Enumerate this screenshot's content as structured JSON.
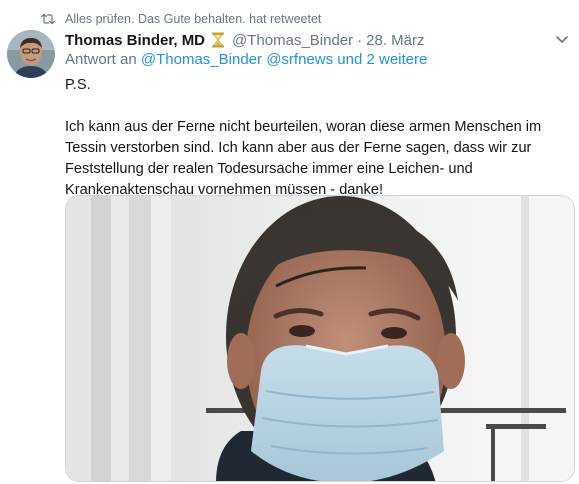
{
  "retweet_context": {
    "text": "Alles prüfen. Das Gute behalten. hat retweetet",
    "icon": "retweet-icon"
  },
  "tweet": {
    "author_name": "Thomas Binder, MD",
    "badge_icon": "hourglass-icon",
    "handle": "@Thomas_Binder",
    "separator": "·",
    "date": "28. März",
    "reply": {
      "prefix": "Antwort an",
      "mentions": [
        "@Thomas_Binder",
        "@srfnews"
      ],
      "suffix": "und 2 weitere"
    },
    "body": {
      "ps": "P.S.",
      "paragraph": "Ich kann aus der Ferne nicht beurteilen, woran diese armen Menschen im Tessin verstorben sind. Ich kann aber aus der Ferne sagen, dass wir zur Feststellung der realen Todesursache immer eine Leichen- und Krankenaktenschau vornehmen müssen - danke!"
    },
    "media": {
      "type": "photo"
    }
  },
  "colors": {
    "link": "#1b95e0",
    "secondary_text": "#657786",
    "primary_text": "#14171a",
    "border": "#ccd6dd"
  }
}
